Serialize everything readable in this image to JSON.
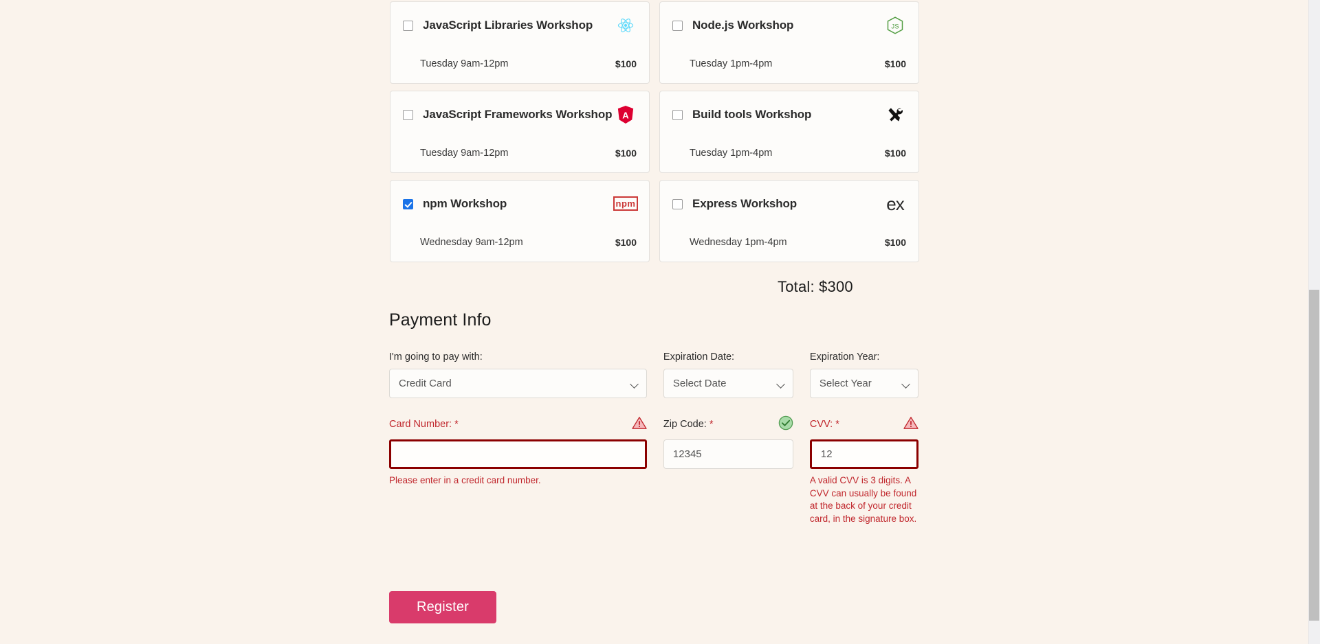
{
  "workshops": {
    "rows": [
      [
        {
          "title": "JavaScript Libraries Workshop",
          "time": "Tuesday 9am-12pm",
          "price": "$100",
          "checked": false,
          "icon": "react-icon"
        },
        {
          "title": "Node.js Workshop",
          "time": "Tuesday 1pm-4pm",
          "price": "$100",
          "checked": false,
          "icon": "nodejs-icon"
        }
      ],
      [
        {
          "title": "JavaScript Frameworks Workshop",
          "time": "Tuesday 9am-12pm",
          "price": "$100",
          "checked": false,
          "icon": "angular-icon"
        },
        {
          "title": "Build tools Workshop",
          "time": "Tuesday 1pm-4pm",
          "price": "$100",
          "checked": false,
          "icon": "hammer-wrench-icon"
        }
      ],
      [
        {
          "title": "npm Workshop",
          "time": "Wednesday 9am-12pm",
          "price": "$100",
          "checked": true,
          "icon": "npm-icon",
          "icon_text": "npm"
        },
        {
          "title": "Express Workshop",
          "time": "Wednesday 1pm-4pm",
          "price": "$100",
          "checked": false,
          "icon": "express-icon",
          "icon_text": "ex"
        }
      ]
    ]
  },
  "total": "Total: $300",
  "payment": {
    "heading": "Payment Info",
    "pay_with": {
      "label": "I'm going to pay with:",
      "value": "Credit Card",
      "options": [
        "Credit Card"
      ]
    },
    "expiration_date": {
      "label": "Expiration Date:",
      "value": "Select Date",
      "options": [
        "Select Date"
      ]
    },
    "expiration_year": {
      "label": "Expiration Year:",
      "value": "Select Year",
      "options": [
        "Select Year"
      ]
    },
    "card_number": {
      "label": "Card Number: ",
      "required_mark": "*",
      "value": "",
      "state": "error",
      "error": "Please enter in a credit card number."
    },
    "zip_code": {
      "label": "Zip Code: ",
      "required_mark": "*",
      "value": "12345",
      "state": "valid",
      "error": ""
    },
    "cvv": {
      "label": "CVV: ",
      "required_mark": "*",
      "value": "12",
      "state": "error",
      "error": "A valid CVV is 3 digits. A CVV can usually be found at the back of your credit card, in the signature box."
    }
  },
  "register_button": "Register",
  "colors": {
    "page_bg": "#faf3ec",
    "card_bg": "#fdfcfa",
    "accent_pink": "#d93b6b",
    "error_red": "#c0262c",
    "error_border": "#8b0000",
    "valid_green": "#6cbf6c",
    "checkbox_blue": "#1a73e8",
    "react_cyan": "#61dafb",
    "angular_red": "#dd0031",
    "node_green": "#539e43",
    "npm_red": "#cb3837"
  }
}
